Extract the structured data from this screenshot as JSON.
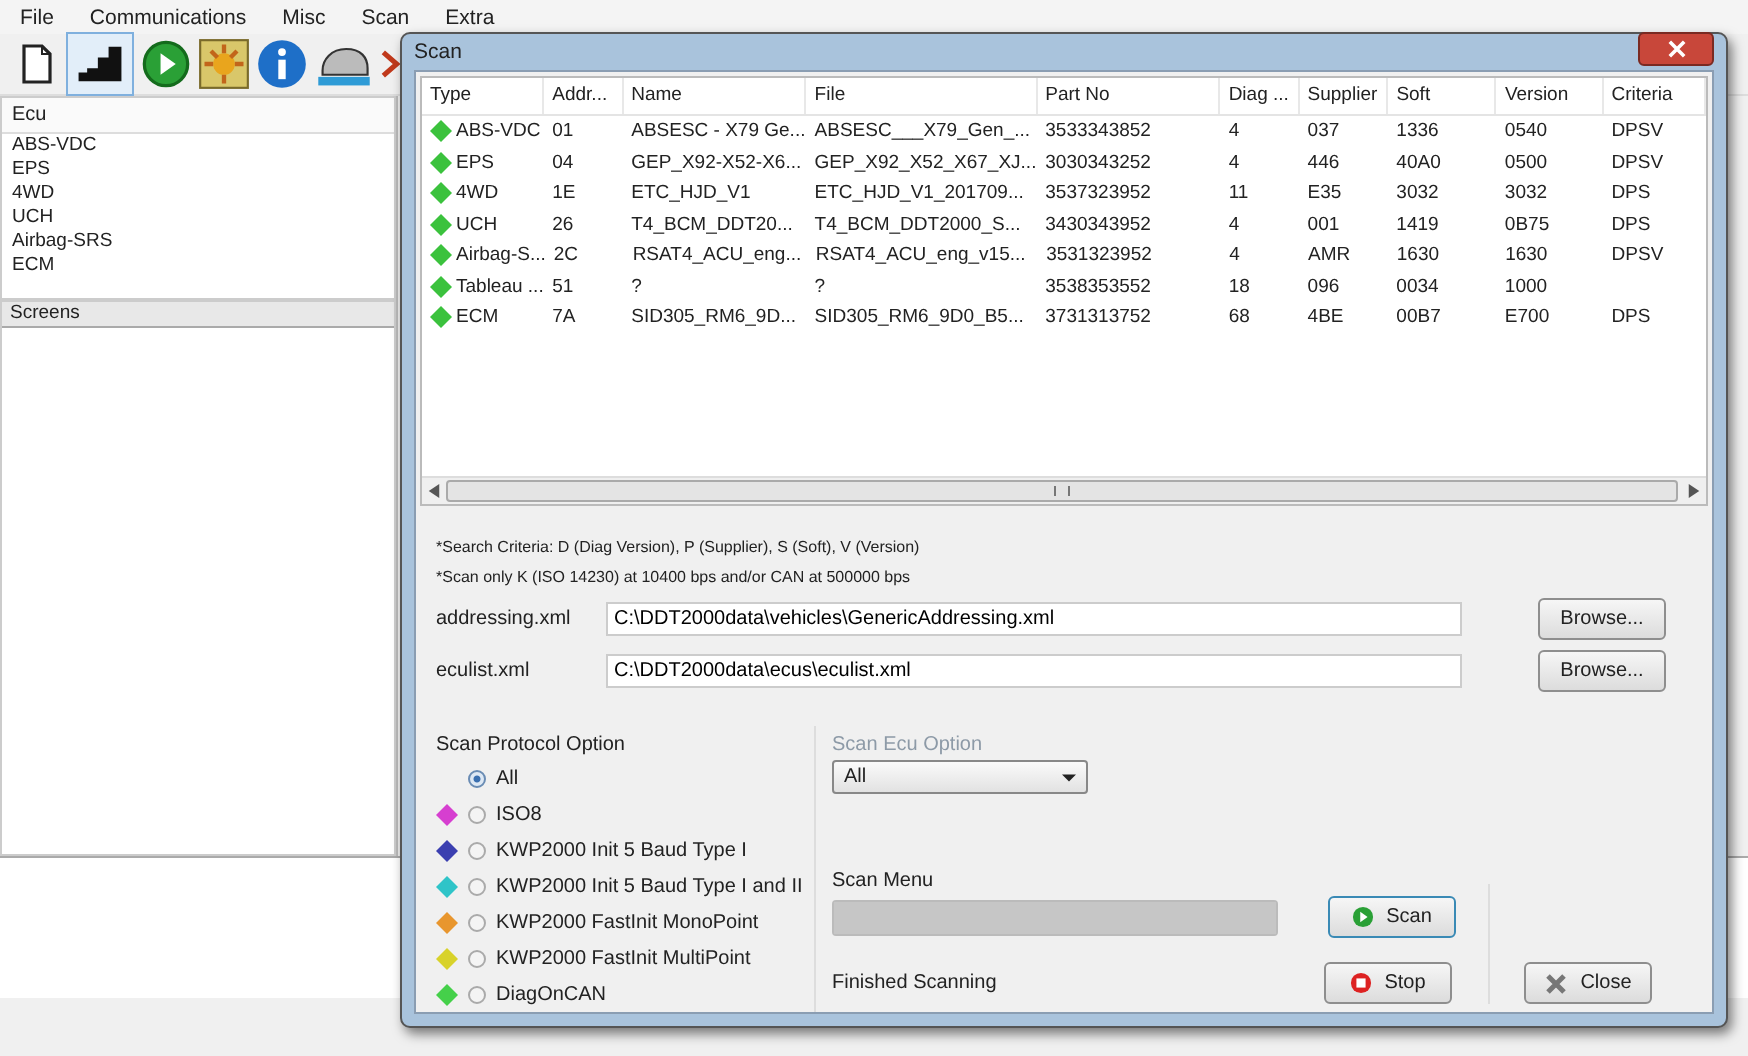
{
  "menu": [
    "File",
    "Communications",
    "Misc",
    "Scan",
    "Extra"
  ],
  "ecu_panel": {
    "header": "Ecu",
    "items": [
      "ABS-VDC",
      "EPS",
      "4WD",
      "UCH",
      "Airbag-SRS",
      "ECM"
    ]
  },
  "screens_panel": {
    "header": "Screens"
  },
  "dialog": {
    "title": "Scan",
    "table": {
      "columns": [
        "Type",
        "Addr...",
        "Name",
        "File",
        "Part No",
        "Diag ...",
        "Supplier",
        "Soft",
        "Version",
        "Criteria"
      ],
      "rows": [
        {
          "cells": [
            "ABS-VDC",
            "01",
            "ABSESC - X79 Ge...",
            "ABSESC___X79_Gen_...",
            "3533343852",
            "4",
            "037",
            "1336",
            "0540",
            "DPSV"
          ]
        },
        {
          "cells": [
            "EPS",
            "04",
            "GEP_X92-X52-X6...",
            "GEP_X92_X52_X67_XJ...",
            "3030343252",
            "4",
            "446",
            "40A0",
            "0500",
            "DPSV"
          ]
        },
        {
          "cells": [
            "4WD",
            "1E",
            "ETC_HJD_V1",
            "ETC_HJD_V1_201709...",
            "3537323952",
            "11",
            "E35",
            "3032",
            "3032",
            "DPS"
          ]
        },
        {
          "cells": [
            "UCH",
            "26",
            "T4_BCM_DDT20...",
            "T4_BCM_DDT2000_S...",
            "3430343952",
            "4",
            "001",
            "1419",
            "0B75",
            "DPS"
          ]
        },
        {
          "cells": [
            "Airbag-S...",
            "2C",
            "RSAT4_ACU_eng...",
            "RSAT4_ACU_eng_v15...",
            "3531323952",
            "4",
            "AMR",
            "1630",
            "1630",
            "DPSV"
          ]
        },
        {
          "cells": [
            "Tableau ...",
            "51",
            "?",
            "?",
            "3538353552",
            "18",
            "096",
            "0034",
            "1000",
            ""
          ]
        },
        {
          "cells": [
            "ECM",
            "7A",
            "SID305_RM6_9D...",
            "SID305_RM6_9D0_B5...",
            "3731313752",
            "68",
            "4BE",
            "00B7",
            "E700",
            "DPS"
          ]
        }
      ]
    },
    "notes": [
      "*Search Criteria: D (Diag Version), P (Supplier), S (Soft), V (Version)",
      "*Scan only K (ISO 14230) at 10400 bps and/or CAN at 500000 bps"
    ],
    "fields": [
      {
        "label": "addressing.xml",
        "value": "C:\\DDT2000data\\vehicles\\GenericAddressing.xml",
        "button": "Browse..."
      },
      {
        "label": "eculist.xml",
        "value": "C:\\DDT2000data\\ecus\\eculist.xml",
        "button": "Browse..."
      }
    ],
    "protocol": {
      "title": "Scan Protocol Option",
      "options": [
        {
          "label": "All",
          "selected": true
        },
        {
          "label": "ISO8",
          "selected": false,
          "color": "#d63fd0"
        },
        {
          "label": "KWP2000 Init 5 Baud Type I",
          "selected": false,
          "color": "#3b3fb0"
        },
        {
          "label": "KWP2000 Init 5 Baud Type I and II",
          "selected": false,
          "color": "#2fc4c8"
        },
        {
          "label": "KWP2000 FastInit MonoPoint",
          "selected": false,
          "color": "#e8962e"
        },
        {
          "label": "KWP2000 FastInit MultiPoint",
          "selected": false,
          "color": "#d8d22a"
        },
        {
          "label": "DiagOnCAN",
          "selected": false,
          "color": "#45d04a"
        }
      ]
    },
    "ecu_option": {
      "title": "Scan Ecu Option",
      "disabled": true,
      "value": "All"
    },
    "scan_menu": {
      "title": "Scan Menu",
      "status": "Finished Scanning",
      "level": 1
    },
    "buttons": [
      {
        "kind": "scan",
        "label": "Scan"
      },
      {
        "kind": "stop",
        "label": "Stop"
      },
      {
        "kind": "close",
        "label": "Close"
      }
    ]
  }
}
